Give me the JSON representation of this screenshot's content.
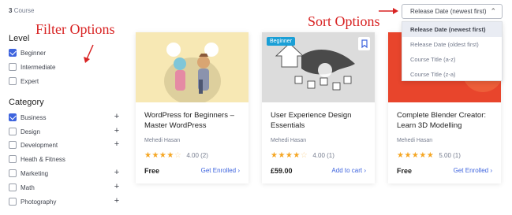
{
  "course_count": {
    "number": "3",
    "label": "Course"
  },
  "annotations": {
    "filter": "Filter Options",
    "sort": "Sort Options"
  },
  "filters": {
    "level": {
      "title": "Level",
      "options": [
        {
          "label": "Beginner",
          "checked": true
        },
        {
          "label": "Intermediate",
          "checked": false
        },
        {
          "label": "Expert",
          "checked": false
        }
      ]
    },
    "category": {
      "title": "Category",
      "options": [
        {
          "label": "Business",
          "checked": true,
          "expandable": true
        },
        {
          "label": "Design",
          "checked": false,
          "expandable": true
        },
        {
          "label": "Development",
          "checked": false,
          "expandable": true
        },
        {
          "label": "Heath & Fitness",
          "checked": false,
          "expandable": false
        },
        {
          "label": "Marketing",
          "checked": false,
          "expandable": true
        },
        {
          "label": "Math",
          "checked": false,
          "expandable": true
        },
        {
          "label": "Photography",
          "checked": false,
          "expandable": true
        }
      ]
    }
  },
  "sort": {
    "selected": "Release Date (newest first)",
    "options": [
      "Release Date (newest first)",
      "Release Date (oldest first)",
      "Course Title (a-z)",
      "Course Title (z-a)"
    ]
  },
  "courses": [
    {
      "title": "WordPress for Beginners – Master WordPress",
      "author": "Mehedi Hasan",
      "stars": 4,
      "rating": "4.00",
      "reviews": "(2)",
      "price": "Free",
      "cta": "Get Enrolled",
      "badge": ""
    },
    {
      "title": "User Experience Design Essentials",
      "author": "Mehedi Hasan",
      "stars": 4,
      "rating": "4.00",
      "reviews": "(1)",
      "price": "£59.00",
      "cta": "Add to cart",
      "badge": "Beginner"
    },
    {
      "title": "Complete Blender Creator: Learn 3D Modelling",
      "author": "Mehedi Hasan",
      "stars": 5,
      "rating": "5.00",
      "reviews": "(1)",
      "price": "Free",
      "cta": "Get Enrolled",
      "badge": ""
    }
  ],
  "colors": {
    "accent": "#3e64de",
    "star": "#f5a623",
    "annotation": "#d82323",
    "badge": "#1a9fd6"
  }
}
